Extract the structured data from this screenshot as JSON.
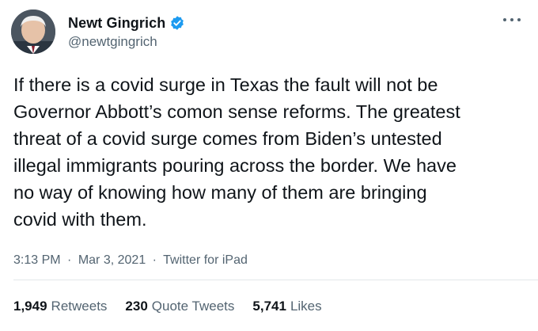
{
  "author": {
    "display_name": "Newt Gingrich",
    "handle": "@newtgingrich",
    "verified": true,
    "verified_icon": "verified-badge-icon"
  },
  "tweet": {
    "lines": [
      "If there is a covid surge in Texas the fault will not be",
      "Governor Abbott’s comon sense reforms. The greatest",
      "threat of a covid surge comes from Biden’s untested",
      "illegal immigrants pouring across the border. We have",
      "no way of knowing how many of them are bringing",
      "covid with them."
    ]
  },
  "meta": {
    "time": "3:13 PM",
    "separator": "·",
    "date": "Mar 3, 2021",
    "source": "Twitter for iPad"
  },
  "stats": {
    "retweets_count": "1,949",
    "retweets_label": "Retweets",
    "quotes_count": "230",
    "quotes_label": "Quote Tweets",
    "likes_count": "5,741",
    "likes_label": "Likes"
  },
  "colors": {
    "verified_blue": "#1d9bf0",
    "muted_text": "#536471",
    "primary_text": "#0f1419"
  }
}
